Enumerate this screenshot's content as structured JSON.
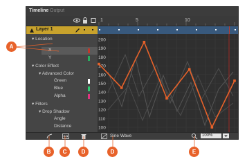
{
  "tabs": [
    {
      "label": "Timeline",
      "active": true
    },
    {
      "label": "Output",
      "active": false
    }
  ],
  "ruler": {
    "frame_labels": [
      "1",
      "5",
      "10"
    ]
  },
  "layer": {
    "name": "Layer 1"
  },
  "properties": {
    "location_group": "Location",
    "x_label": "X",
    "y_label": "Y",
    "color_effect_group": "Color Effect",
    "advanced_color_group": "Advanced Color",
    "green_label": "Green",
    "blue_label": "Blue",
    "alpha_label": "Alpha",
    "filters_group": "Filters",
    "drop_shadow_group": "Drop Shadow",
    "angle_label": "Angle",
    "distance_label": "Distance"
  },
  "graph": {
    "y_ticks": [
      "200",
      "190",
      "180",
      "170",
      "160",
      "150",
      "140",
      "130",
      "120",
      "110",
      "100"
    ],
    "selected_series_values": [
      172,
      145,
      197,
      133,
      166,
      100,
      153
    ],
    "range": [
      100,
      200
    ]
  },
  "bottom_bar": {
    "ease_label": "Sine Wave",
    "zoom_value": "100%"
  },
  "callouts": {
    "a": "A",
    "b": "B",
    "c": "C",
    "d1": "D",
    "d2": "D",
    "e": "E"
  },
  "colors": {
    "accent": "#e8622a",
    "layer_row": "#c8a22c",
    "keyframe_row": "#38597d",
    "x_swatch": "#c0392b",
    "y_swatch": "#27ae60",
    "green_swatch": "#ffffff",
    "blue_swatch": "#2ecc71",
    "alpha_swatch": "#e0357f"
  }
}
